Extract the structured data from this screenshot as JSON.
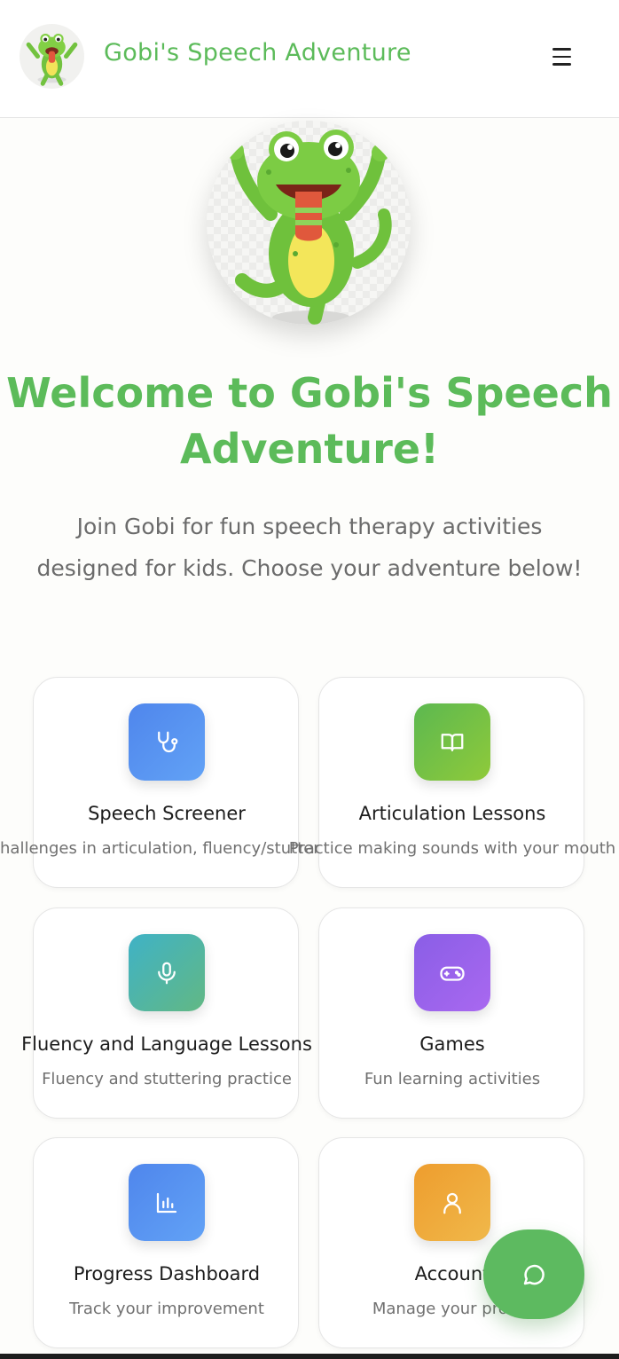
{
  "header": {
    "brand": "Gobi's Speech Adventure",
    "logo_icon": "gobi-frog-logo",
    "menu_icon": "hamburger-menu-icon"
  },
  "hero": {
    "image": "gobi-frog-mascot",
    "title": "Welcome to Gobi's Speech Adventure!",
    "subtitle": "Join Gobi for fun speech therapy activities designed for kids. Choose your adventure below!"
  },
  "cards": [
    {
      "title": "Speech Screener",
      "desc": "Challenges in articulation, fluency/stuttering",
      "icon": "stethoscope-icon",
      "gradient": [
        "#4f86ec",
        "#62a2f6"
      ]
    },
    {
      "title": "Articulation Lessons",
      "desc": "Practice making sounds with your mouth",
      "icon": "book-icon",
      "gradient": [
        "#5cb850",
        "#8fca3a"
      ]
    },
    {
      "title": "Fluency and Language Lessons",
      "desc": "Fluency and stuttering practice",
      "icon": "microphone-icon",
      "gradient": [
        "#3fb2c6",
        "#62b884"
      ]
    },
    {
      "title": "Games",
      "desc": "Fun learning activities",
      "icon": "gamepad-icon",
      "gradient": [
        "#8a5ee6",
        "#a968f0"
      ]
    },
    {
      "title": "Progress Dashboard",
      "desc": "Track your improvement",
      "icon": "bar-chart-icon",
      "gradient": [
        "#4f86ec",
        "#62a2f6"
      ]
    },
    {
      "title": "Account",
      "desc": "Manage your profile",
      "icon": "user-icon",
      "gradient": [
        "#ee9d2e",
        "#f0b84a"
      ]
    }
  ],
  "fab": {
    "icon": "chat-bubble-icon"
  },
  "colors": {
    "brand_green": "#5cbb5a"
  }
}
